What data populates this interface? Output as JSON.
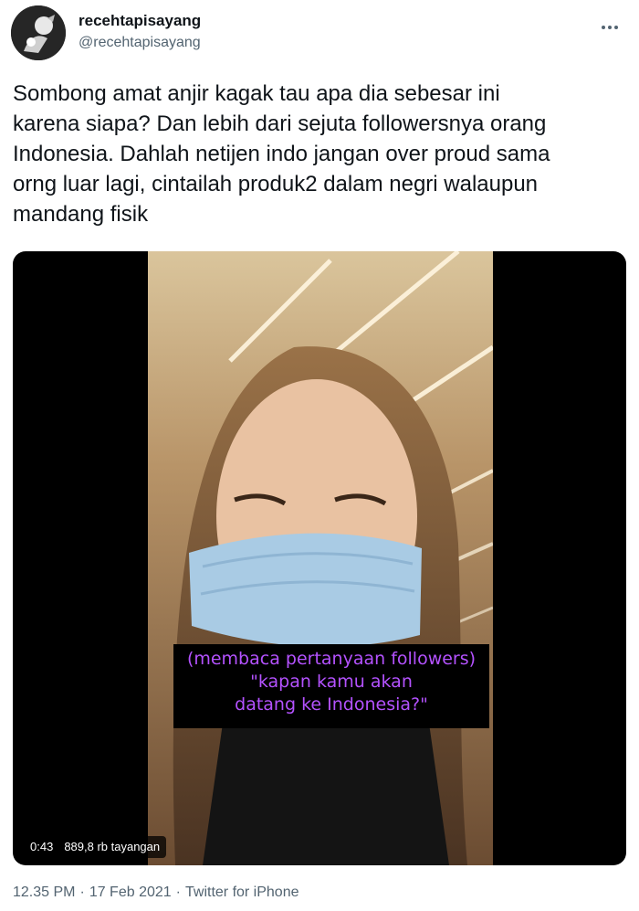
{
  "user": {
    "display_name": "recehtapisayang",
    "handle": "@recehtapisayang",
    "avatar_icon": "avatar-image"
  },
  "tweet": {
    "text": "Sombong amat anjir kagak tau apa dia sebesar ini\nkarena siapa? Dan lebih dari sejuta followersnya orang\nIndonesia. Dahlah netijen indo jangan over proud sama\norng luar lagi, cintailah produk2 dalam negri walaupun\nmandang fisik"
  },
  "video": {
    "caption_line1": "(membaca pertanyaan followers)",
    "caption_line2": "\"kapan kamu akan",
    "caption_line3": "datang ke Indonesia?\"",
    "duration": "0:43",
    "views": "889,8 rb tayangan",
    "caption_color": "#b452ff"
  },
  "footer": {
    "time": "12.35 PM",
    "date": "17 Feb 2021",
    "source": "Twitter for iPhone",
    "separator": "·"
  },
  "colors": {
    "text_primary": "#0f1419",
    "text_secondary": "#536471"
  }
}
